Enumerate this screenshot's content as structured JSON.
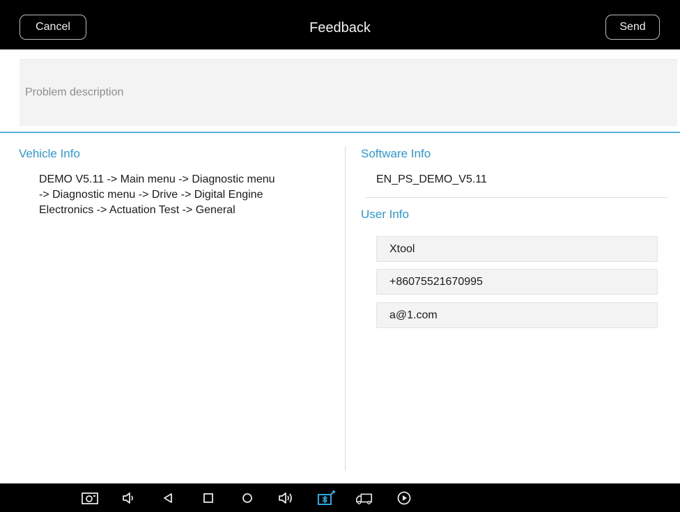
{
  "header": {
    "title": "Feedback",
    "cancel_label": "Cancel",
    "send_label": "Send"
  },
  "problem": {
    "placeholder": "Problem description"
  },
  "vehicle": {
    "title": "Vehicle Info",
    "path_lines": [
      "DEMO V5.11 -> Main menu -> Diagnostic menu",
      "-> Diagnostic menu -> Drive -> Digital Engine",
      "Electronics -> Actuation Test -> General"
    ]
  },
  "software": {
    "title": "Software Info",
    "version": "EN_PS_DEMO_V5.11"
  },
  "user": {
    "title": "User Info",
    "name": "Xtool",
    "phone": "+86075521670995",
    "email": "a@1.com"
  },
  "navbar": {
    "icons": [
      "screenshot-icon",
      "volume-down-icon",
      "back-icon",
      "recents-icon",
      "home-icon",
      "volume-up-icon",
      "vci-icon",
      "truck-icon",
      "play-icon"
    ],
    "active_color": "#27a9e1"
  },
  "colors": {
    "accent": "#2b9ad6",
    "divider": "#55b2dd"
  }
}
